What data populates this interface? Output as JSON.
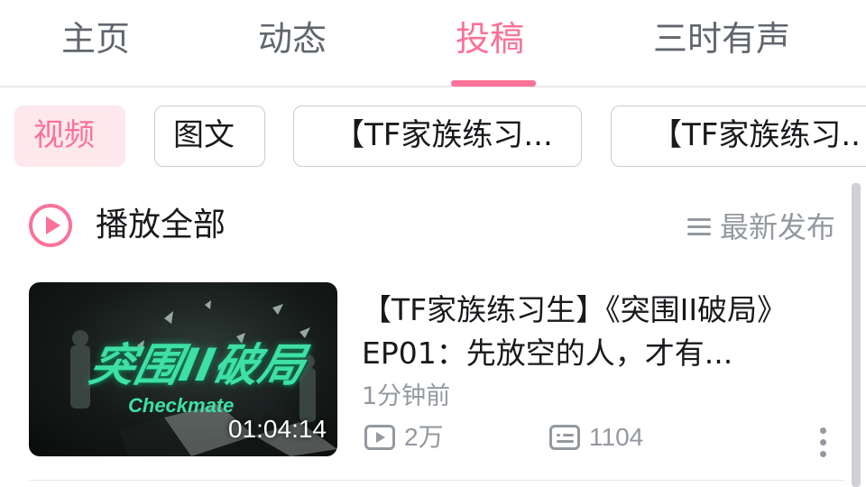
{
  "tabs": [
    {
      "label": "主页",
      "active": false
    },
    {
      "label": "动态",
      "active": false
    },
    {
      "label": "投稿",
      "active": true
    },
    {
      "label": "三时有声",
      "active": false
    }
  ],
  "filters": [
    {
      "label": "视频",
      "active": true
    },
    {
      "label": "图文",
      "active": false
    },
    {
      "label": "【TF家族练习...",
      "active": false
    },
    {
      "label": "【TF家族练习..",
      "active": false
    }
  ],
  "toolbar": {
    "play_all_label": "播放全部",
    "sort_label": "最新发布"
  },
  "video": {
    "thumbnail_text": "突围II破局",
    "thumbnail_subtext": "Checkmate",
    "duration": "01:04:14",
    "title": "【TF家族练习生】《突围II破局》EP01：先放空的人，才有...",
    "time": "1分钟前",
    "play_count": "2万",
    "danmaku_count": "1104"
  },
  "colors": {
    "accent": "#fb7299",
    "chip_active_bg": "#fde8ee",
    "muted_text": "#9499a0",
    "primary_text": "#18191c"
  },
  "icons": {
    "play_all": "play-circle-icon",
    "sort": "menu-lines-icon",
    "play_count": "play-box-icon",
    "danmaku": "danmaku-box-icon",
    "more": "more-vertical-icon"
  }
}
